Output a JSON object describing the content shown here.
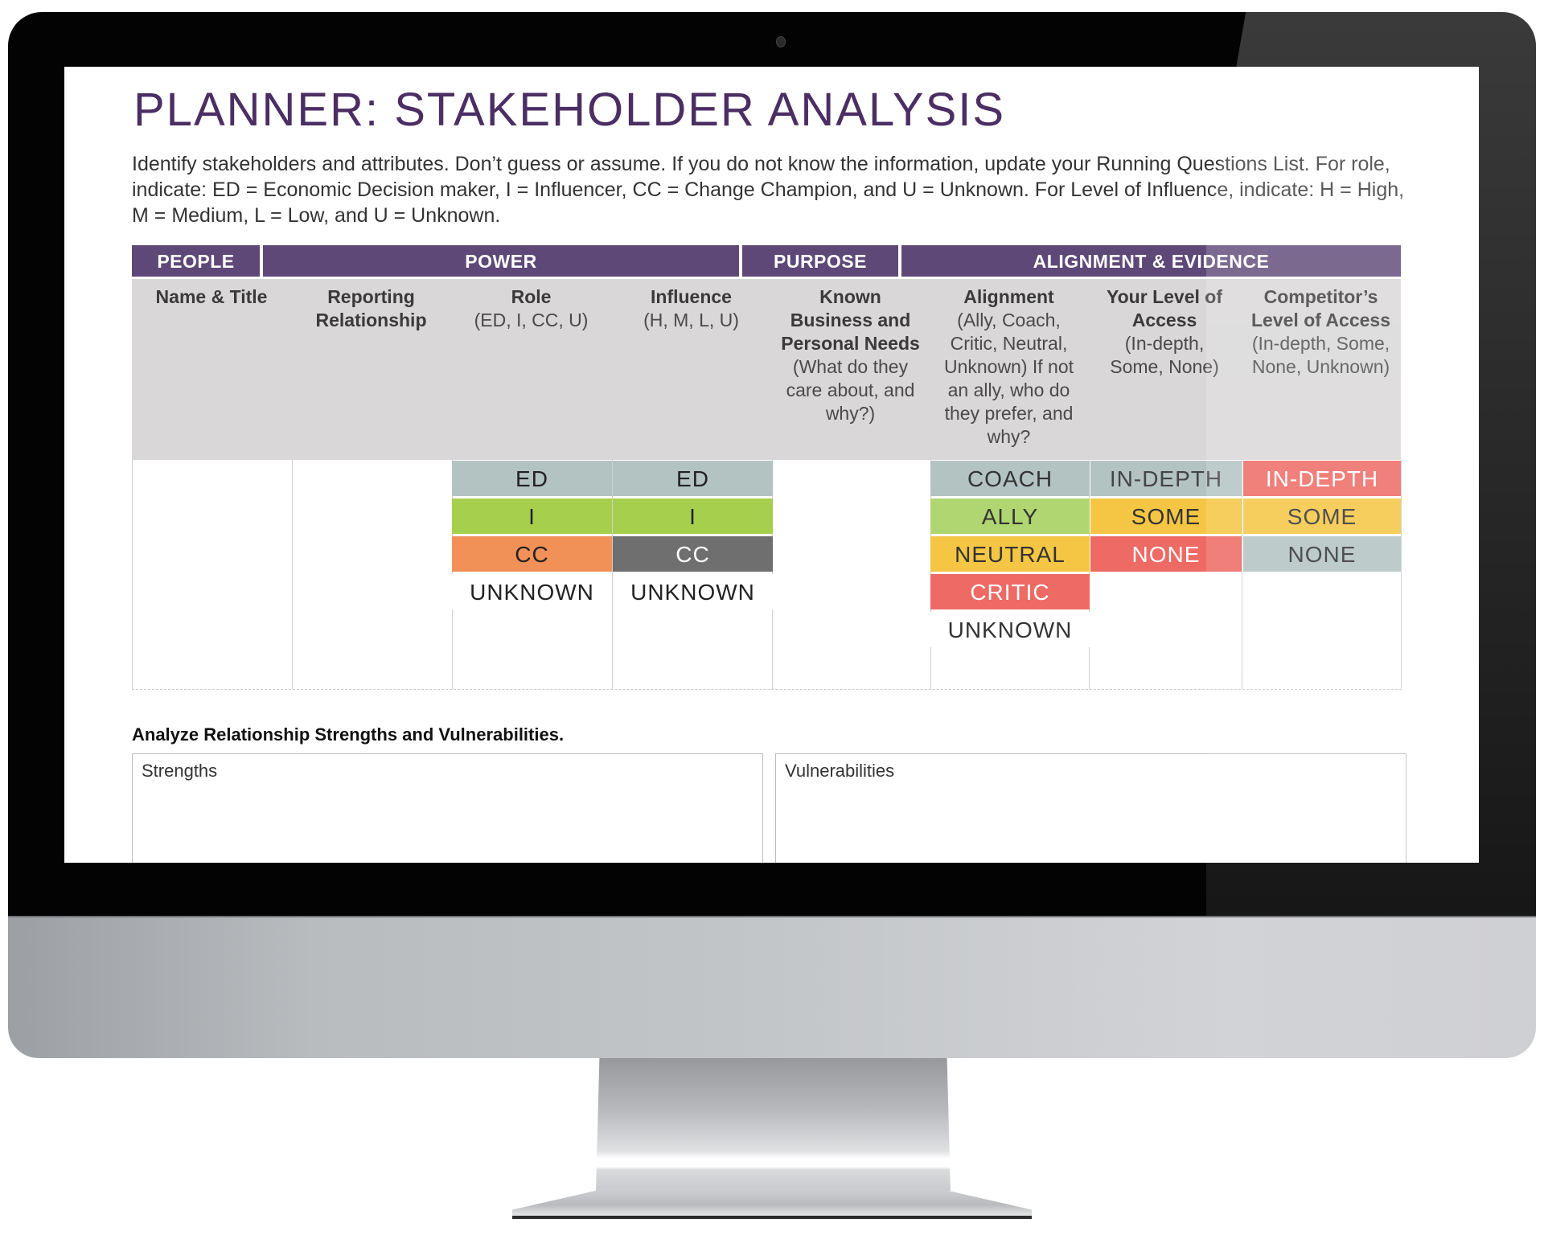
{
  "document": {
    "title": "PLANNER:  STAKEHOLDER ANALYSIS",
    "intro": "Identify stakeholders and attributes.  Don’t guess or assume.  If you do not know the information, update your Running Questions List.  For role, indicate:  ED = Economic Decision maker, I = Influencer, CC = Change Champion, and U = Unknown.  For Level of Influence, indicate:  H = High, M = Medium, L = Low, and U = Unknown."
  },
  "colors": {
    "header_purple": "#5e4878",
    "title_purple": "#4b2e63",
    "subheader_gray": "#d9d7d8",
    "gray_teal": "#b3c3c2",
    "green": "#a6cf4e",
    "orange": "#f29157",
    "dark_gray": "#6f6f6f",
    "yellow": "#f5c643",
    "red": "#ee6a64"
  },
  "table": {
    "groups": [
      "PEOPLE",
      "POWER",
      "PURPOSE",
      "ALIGNMENT & EVIDENCE"
    ],
    "columns": [
      {
        "title": "Name & Title",
        "hint": ""
      },
      {
        "title": "Reporting Relationship",
        "hint": ""
      },
      {
        "title": "Role",
        "hint": "(ED, I, CC, U)"
      },
      {
        "title": "Influence",
        "hint": "(H, M, L, U)"
      },
      {
        "title": "Known Business and Personal Needs",
        "hint": "(What do they care about, and why?)"
      },
      {
        "title": "Alignment",
        "hint": "(Ally, Coach, Critic, Neutral, Unknown) If not an ally, who do they prefer, and why?"
      },
      {
        "title": "Your Level of Access",
        "hint": "(In-depth, Some, None)"
      },
      {
        "title": "Competitor’s Level of Access",
        "hint": "(In-depth, Some, None, Unknown)"
      }
    ],
    "role_options": [
      {
        "label": "ED",
        "color": "#b3c3c2",
        "text": "#222222"
      },
      {
        "label": "I",
        "color": "#a6cf4e",
        "text": "#222222"
      },
      {
        "label": "CC",
        "color": "#f29157",
        "text": "#222222"
      },
      {
        "label": "UNKNOWN",
        "color": "#ffffff",
        "text": "#222222"
      }
    ],
    "influence_options": [
      {
        "label": "ED",
        "color": "#b3c3c2",
        "text": "#222222"
      },
      {
        "label": "I",
        "color": "#a6cf4e",
        "text": "#222222"
      },
      {
        "label": "CC",
        "color": "#6f6f6f",
        "text": "#ffffff"
      },
      {
        "label": "UNKNOWN",
        "color": "#ffffff",
        "text": "#222222"
      }
    ],
    "alignment_options": [
      {
        "label": "COACH",
        "color": "#b3c3c2",
        "text": "#333333"
      },
      {
        "label": "ALLY",
        "color": "#b0d672",
        "text": "#333333"
      },
      {
        "label": "NEUTRAL",
        "color": "#f5c643",
        "text": "#333333"
      },
      {
        "label": "CRITIC",
        "color": "#ee6a64",
        "text": "#ffffff"
      },
      {
        "label": "UNKNOWN",
        "color": "#ffffff",
        "text": "#333333"
      }
    ],
    "your_access_options": [
      {
        "label": "IN-DEPTH",
        "color": "#b3c3c2",
        "text": "#444444"
      },
      {
        "label": "SOME",
        "color": "#f5c643",
        "text": "#333333"
      },
      {
        "label": "NONE",
        "color": "#ee6a64",
        "text": "#ffffff"
      }
    ],
    "competitor_access_options": [
      {
        "label": "IN-DEPTH",
        "color": "#ee6a64",
        "text": "#ffffff"
      },
      {
        "label": "SOME",
        "color": "#f5c643",
        "text": "#333333"
      },
      {
        "label": "NONE",
        "color": "#b3c3c2",
        "text": "#333333"
      }
    ]
  },
  "analysis": {
    "title": "Analyze Relationship Strengths and Vulnerabilities.",
    "strengths_label": "Strengths",
    "vulnerabilities_label": "Vulnerabilities"
  }
}
